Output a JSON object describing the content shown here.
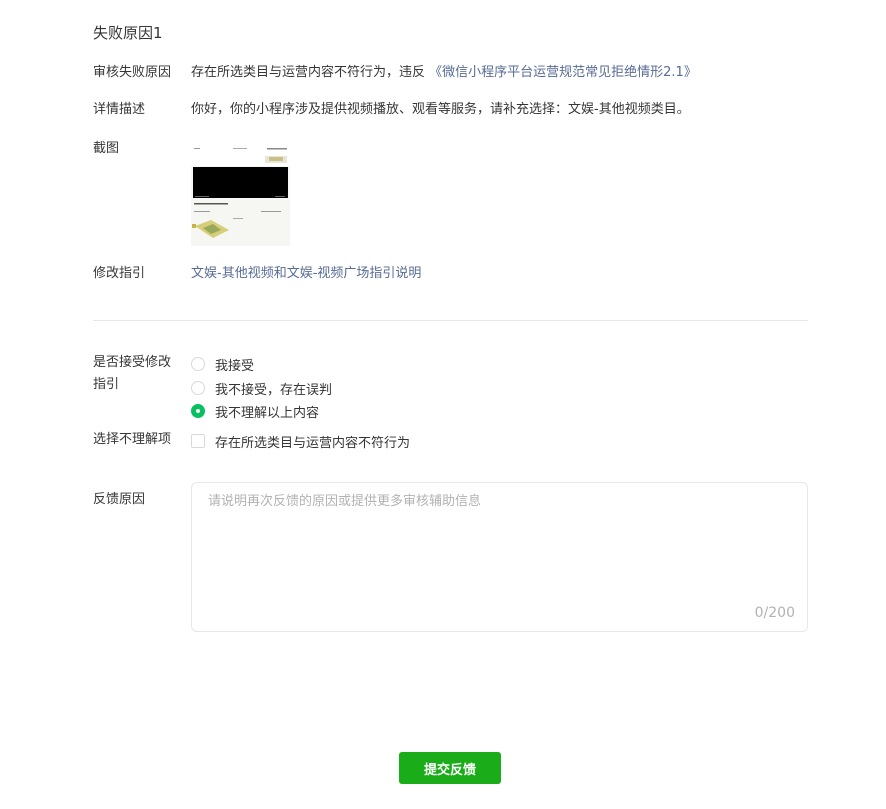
{
  "section": {
    "title": "失败原因1"
  },
  "reason": {
    "label": "审核失败原因",
    "text": "存在所选类目与运营内容不符行为，违反 ",
    "link": "《微信小程序平台运营规范常见拒绝情形2.1》"
  },
  "detail": {
    "label": "详情描述",
    "text": "你好，你的小程序涉及提供视频播放、观看等服务，请补充选择：文娱-其他视频类目。"
  },
  "screenshot": {
    "label": "截图"
  },
  "guide": {
    "label": "修改指引",
    "link": "文娱-其他视频和文娱-视频广场指引说明"
  },
  "accept": {
    "label_line1": "是否接受修改",
    "label_line2": "指引",
    "options": [
      {
        "label": "我接受",
        "checked": false
      },
      {
        "label": "我不接受，存在误判",
        "checked": false
      },
      {
        "label": "我不理解以上内容",
        "checked": true
      }
    ]
  },
  "unclear": {
    "label": "选择不理解项",
    "option": "存在所选类目与运营内容不符行为",
    "checked": false
  },
  "feedback": {
    "label": "反馈原因",
    "placeholder": "请说明再次反馈的原因或提供更多审核辅助信息",
    "value": "",
    "counter": "0/200"
  },
  "submit": {
    "label": "提交反馈"
  },
  "colors": {
    "accent": "#1aad19",
    "radio_checked": "#07c160",
    "link": "#576b95"
  }
}
